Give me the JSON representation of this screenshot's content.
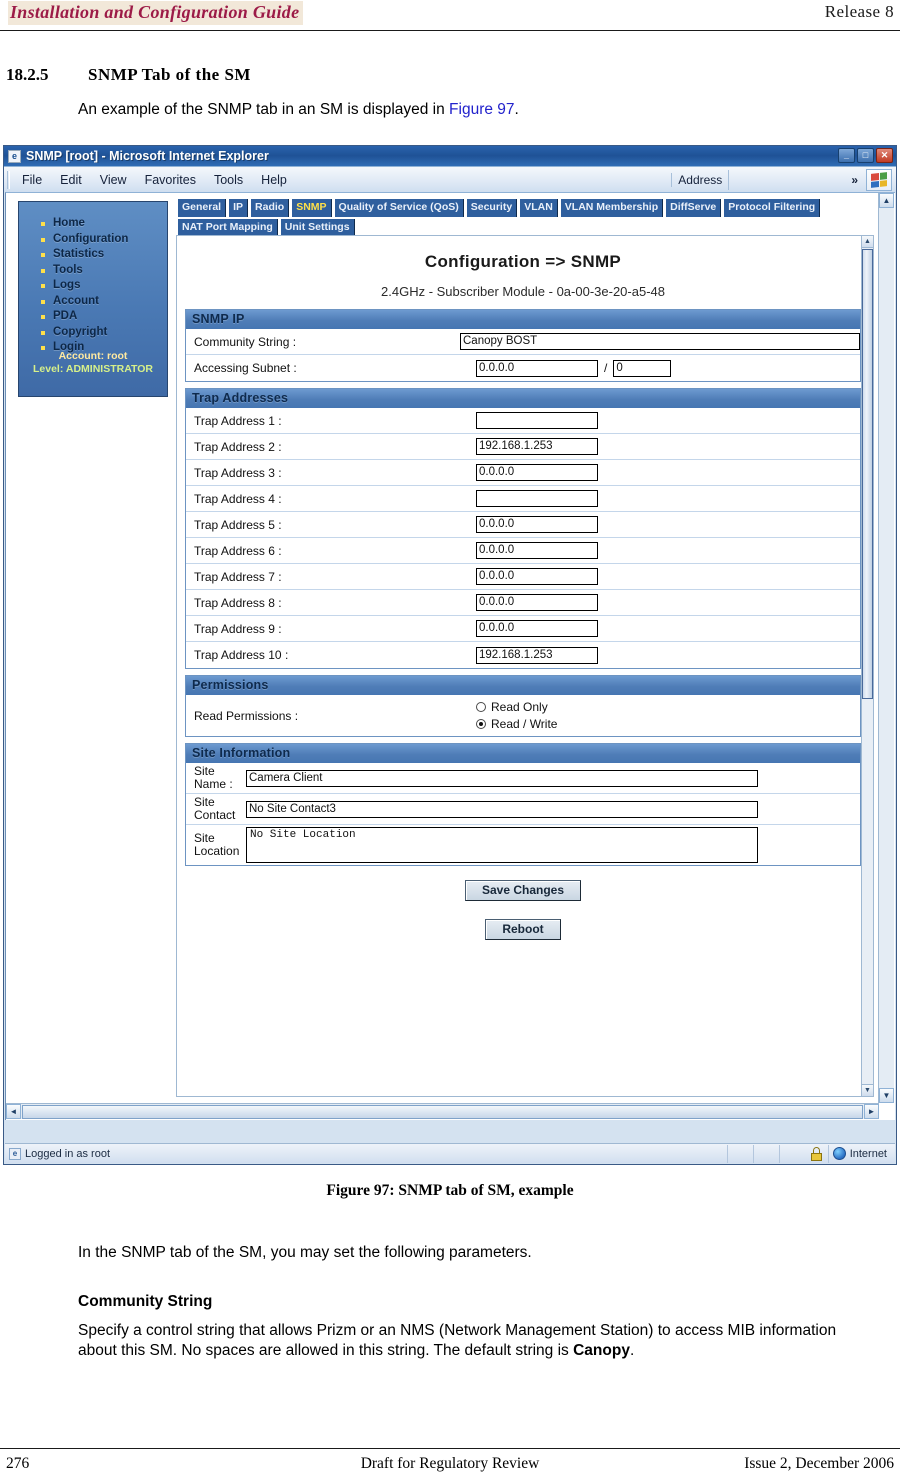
{
  "document": {
    "header_left": "Installation and Configuration Guide",
    "header_right": "Release 8",
    "section_number": "18.2.5",
    "section_title": "SNMP Tab of the SM",
    "intro_before": "An example of the SNMP tab in an SM is displayed in ",
    "intro_link": "Figure 97",
    "intro_after": ".",
    "figure_caption": "Figure 97: SNMP tab of SM, example",
    "paragraph_1": "In the SNMP tab of the SM, you may set the following parameters.",
    "run_in_heading": "Community String",
    "paragraph_2_a": "Specify a control string that allows Prizm or an NMS (Network Management Station) to access MIB information about this SM. No spaces are allowed in this string. The default string is ",
    "paragraph_2_bold": "Canopy",
    "paragraph_2_b": ".",
    "footer_page": "276",
    "footer_center": "Draft for Regulatory Review",
    "footer_right": "Issue 2, December 2006"
  },
  "browser": {
    "title": "SNMP [root] - Microsoft Internet Explorer",
    "title_icon": "ie-document-icon",
    "window_buttons": {
      "minimize": "_",
      "maximize": "□",
      "close": "✕"
    },
    "menus": [
      "File",
      "Edit",
      "View",
      "Favorites",
      "Tools",
      "Help"
    ],
    "address_label": "Address",
    "overflow_chevron": "»",
    "logo_icon": "windows-flag-icon",
    "status_text": "Logged in as root",
    "status_zone": "Internet",
    "status_lock_icon": "lock-icon",
    "status_globe_icon": "globe-icon"
  },
  "canopy": {
    "sidebar": {
      "items": [
        "Home",
        "Configuration",
        "Statistics",
        "Tools",
        "Logs",
        "Account",
        "PDA",
        "Copyright",
        "Login"
      ],
      "account_line": "Account: root",
      "level_line": "Level: ADMINISTRATOR"
    },
    "tabs": [
      {
        "label": "General",
        "active": false
      },
      {
        "label": "IP",
        "active": false
      },
      {
        "label": "Radio",
        "active": false
      },
      {
        "label": "SNMP",
        "active": true
      },
      {
        "label": "Quality of Service (QoS)",
        "active": false
      },
      {
        "label": "Security",
        "active": false
      },
      {
        "label": "VLAN",
        "active": false
      },
      {
        "label": "VLAN Membership",
        "active": false
      },
      {
        "label": "DiffServe",
        "active": false
      },
      {
        "label": "Protocol Filtering",
        "active": false
      },
      {
        "label": "NAT Port Mapping",
        "active": false
      },
      {
        "label": "Unit Settings",
        "active": false
      }
    ],
    "page_title": "Configuration => SNMP",
    "page_subtitle": "2.4GHz - Subscriber Module - 0a-00-3e-20-a5-48",
    "snmp_ip": {
      "heading": "SNMP IP",
      "community_string_label": "Community String :",
      "community_string_value": "Canopy BOST",
      "accessing_subnet_label": "Accessing Subnet :",
      "accessing_subnet_value": "0.0.0.0",
      "accessing_subnet_separator": "/",
      "accessing_subnet_mask": "0"
    },
    "trap_addresses": {
      "heading": "Trap Addresses",
      "rows": [
        {
          "label": "Trap Address 1 :",
          "value": ""
        },
        {
          "label": "Trap Address 2 :",
          "value": "192.168.1.253"
        },
        {
          "label": "Trap Address 3 :",
          "value": "0.0.0.0"
        },
        {
          "label": "Trap Address 4 :",
          "value": ""
        },
        {
          "label": "Trap Address 5 :",
          "value": "0.0.0.0"
        },
        {
          "label": "Trap Address 6 :",
          "value": "0.0.0.0"
        },
        {
          "label": "Trap Address 7 :",
          "value": "0.0.0.0"
        },
        {
          "label": "Trap Address 8 :",
          "value": "0.0.0.0"
        },
        {
          "label": "Trap Address 9 :",
          "value": "0.0.0.0"
        },
        {
          "label": "Trap Address 10 :",
          "value": "192.168.1.253"
        }
      ]
    },
    "permissions": {
      "heading": "Permissions",
      "label": "Read Permissions :",
      "option_read_only": "Read Only",
      "option_read_write": "Read / Write",
      "selected": "Read / Write"
    },
    "site_information": {
      "heading": "Site Information",
      "site_name_label": "Site\nName :",
      "site_name_label_1": "Site",
      "site_name_label_2": "Name :",
      "site_name_value": "Camera Client",
      "site_contact_label_1": "Site",
      "site_contact_label_2": "Contact",
      "site_contact_value": "No Site Contact3",
      "site_location_label_1": "Site",
      "site_location_label_2": "Location",
      "site_location_value": "No Site Location"
    },
    "buttons": {
      "save": "Save Changes",
      "reboot": "Reboot"
    }
  }
}
